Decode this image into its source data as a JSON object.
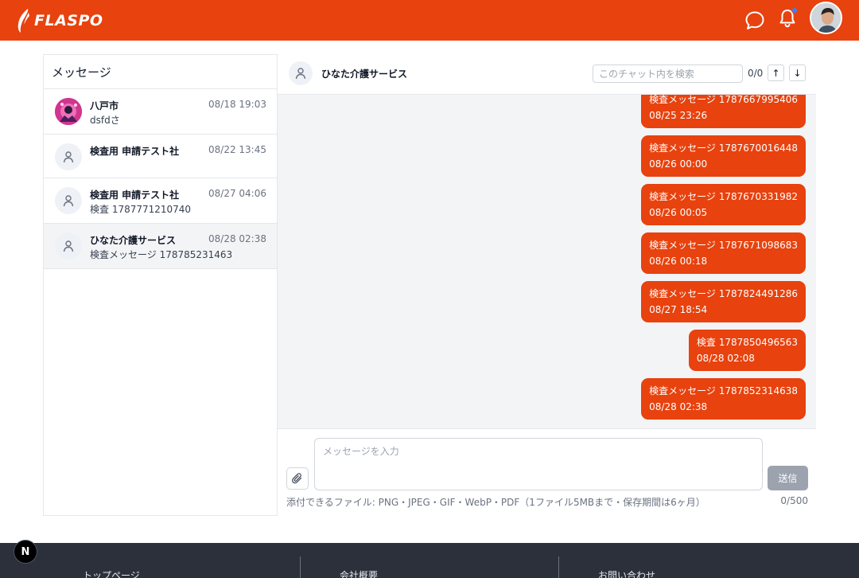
{
  "header": {
    "logo_text": "FLASPO",
    "icons": [
      "chat-icon",
      "bell-icon",
      "user-avatar"
    ],
    "brand_color": "#e8420e",
    "notification_dot_color": "#3b82f6"
  },
  "sidebar": {
    "title": "メッセージ",
    "conversations": [
      {
        "name": "八戸市",
        "date": "08/18 19:03",
        "preview": "dsfdさ",
        "avatar": "image"
      },
      {
        "name": "検査用 申請テスト社",
        "date": "08/22 13:45",
        "preview": "",
        "avatar": "user-icon"
      },
      {
        "name": "検査用 申請テスト社",
        "date": "08/27 04:06",
        "preview": "検査 1787771210740",
        "avatar": "user-icon"
      },
      {
        "name": "ひなた介護サービス",
        "date": "08/28 02:38",
        "preview": "検査メッセージ 178785231463",
        "avatar": "user-icon",
        "active": true
      }
    ]
  },
  "chat": {
    "title": "ひなた介護サービス",
    "search_placeholder": "このチャット内を検索",
    "match_count": "0/0",
    "up_label": "↑",
    "down_label": "↓",
    "messages": [
      {
        "text": "検査メッセージ 1787667995406",
        "time": "08/25 23:26"
      },
      {
        "text": "検査メッセージ 1787670016448",
        "time": "08/26 00:00"
      },
      {
        "text": "検査メッセージ 1787670331982",
        "time": "08/26 00:05"
      },
      {
        "text": "検査メッセージ 1787671098683",
        "time": "08/26 00:18"
      },
      {
        "text": "検査メッセージ 1787824491286",
        "time": "08/27 18:54"
      },
      {
        "text": "検査 1787850496563",
        "time": "08/28 02:08"
      },
      {
        "text": "検査メッセージ 1787852314638",
        "time": "08/28 02:38"
      }
    ]
  },
  "composer": {
    "placeholder": "メッセージを入力",
    "send_label": "送信",
    "note": "添付できるファイル: PNG・JPEG・GIF・WebP・PDF（1ファイル5MBまで・保存期間は6ヶ月）",
    "char_count": "0/500"
  },
  "footer": {
    "links": [
      "トップページ",
      "会社概要",
      "お問い合わせ"
    ]
  },
  "dev_badge": "N"
}
